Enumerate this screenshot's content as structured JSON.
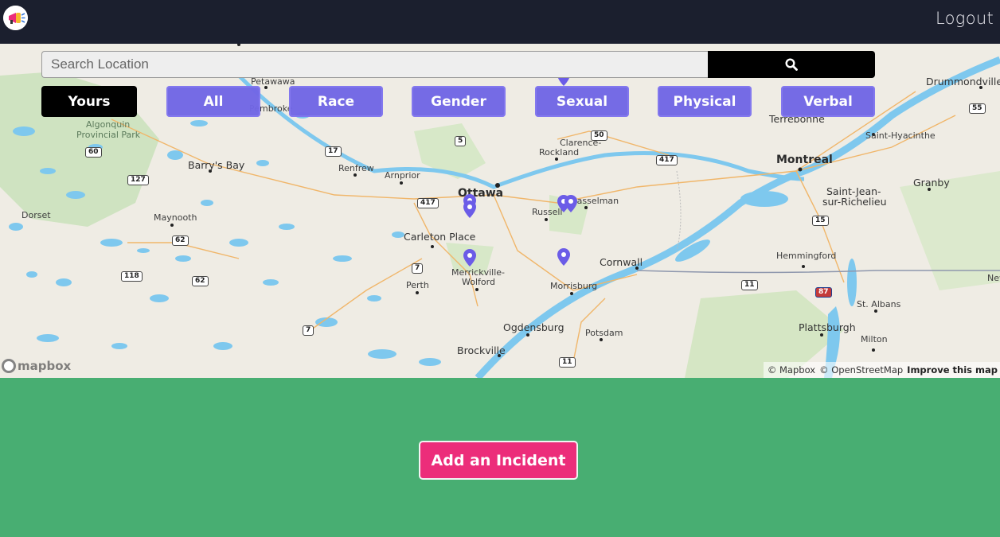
{
  "nav": {
    "logout_label": "Logout",
    "logo_icon": "megaphone-logo-icon"
  },
  "search": {
    "placeholder": "Search Location",
    "value": "",
    "button_icon": "search-icon"
  },
  "filters": [
    {
      "label": "Yours",
      "active": true
    },
    {
      "label": "All",
      "active": false
    },
    {
      "label": "Race",
      "active": false
    },
    {
      "label": "Gender",
      "active": false
    },
    {
      "label": "Sexual",
      "active": false
    },
    {
      "label": "Physical",
      "active": false
    },
    {
      "label": "Verbal",
      "active": false
    }
  ],
  "map": {
    "labels": {
      "montreal": "Montreal",
      "ottawa": "Ottawa",
      "drummondville": "Drummondville",
      "terrebonne": "Terrebonne",
      "saint_hyacinthe": "Saint-Hyacinthe",
      "granby": "Granby",
      "saint_jean": "Saint-Jean-",
      "sur_richelieu": "sur-Richelieu",
      "hemmingford": "Hemmingford",
      "st_albans": "St. Albans",
      "plattsburgh": "Plattsburgh",
      "milton": "Milton",
      "cornwall": "Cornwall",
      "morrisburg": "Morrisburg",
      "potsdam": "Potsdam",
      "ogdensburg": "Ogdensburg",
      "brockville": "Brockville",
      "merrickville": "Merrickville-",
      "wolford": "Wolford",
      "perth": "Perth",
      "carleton_place": "Carleton Place",
      "russell": "Russell",
      "casselman": "Casselman",
      "clarence": "Clarence-",
      "rockland": "Rockland",
      "arnprior": "Arnprior",
      "renfrew": "Renfrew",
      "barrys_bay": "Barry's Bay",
      "maynooth": "Maynooth",
      "dorset": "Dorset",
      "petawawa": "Petawawa",
      "pembroke": "Pembroke",
      "algonquin": "Algonquin",
      "provincial_park": "Provincial Park",
      "new": "New"
    },
    "shields": {
      "r55": "55",
      "r50": "50",
      "r417a": "417",
      "r417b": "417",
      "r5": "5",
      "r17": "17",
      "r60": "60",
      "r127": "127",
      "r62a": "62",
      "r62b": "62",
      "r118": "118",
      "r7a": "7",
      "r7b": "7",
      "r15": "15",
      "r11a": "11",
      "r11b": "11",
      "r87": "87"
    },
    "marker_color": "#6b5ce7",
    "logo_text": "mapbox",
    "attribution_mapbox": "© Mapbox",
    "attribution_osm": "© OpenStreetMap",
    "improve_link": "Improve this map"
  },
  "footer": {
    "add_incident_label": "Add an Incident",
    "background_color": "#48ae72",
    "button_color": "#ec2d7a"
  }
}
